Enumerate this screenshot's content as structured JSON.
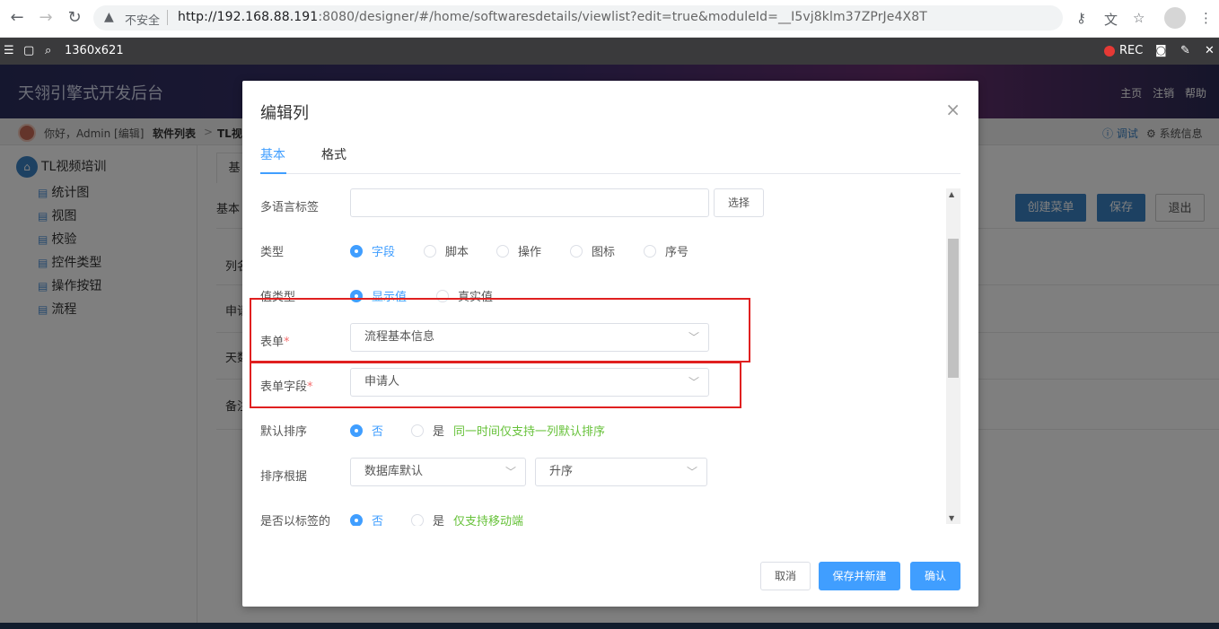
{
  "browser": {
    "insecure_label": "不安全",
    "url_host": "http://192.168.88.191",
    "url_rest": ":8080/designer/#/home/softwaresdetails/viewlist?edit=true&moduleId=__I5vj8klm37ZPrJe4X8T"
  },
  "devbar": {
    "size": "1360x621",
    "rec": "REC"
  },
  "app": {
    "title": "天翎引擎式开发后台",
    "links": [
      "主页",
      "注销",
      "帮助"
    ],
    "greeting": "你好，Admin [编辑]",
    "breadcrumb": [
      "软件列表",
      "TL视"
    ],
    "right_links": [
      "调试",
      "系统信息"
    ],
    "tree_root": "TL视频培训",
    "tree_items": [
      "统计图",
      "视图",
      "校验",
      "控件类型",
      "操作按钮",
      "流程"
    ],
    "content_tab": "基",
    "content_left_labels": [
      "基本",
      "列名",
      "申请",
      "天数",
      "备注"
    ],
    "buttons": {
      "create_menu": "创建菜单",
      "save": "保存",
      "exit": "退出"
    }
  },
  "dialog": {
    "title": "编辑列",
    "tabs": [
      "基本",
      "格式"
    ],
    "fields": {
      "multilang_label": "多语言标签",
      "choose_btn": "选择",
      "type_label": "类型",
      "type_options": [
        "字段",
        "脚本",
        "操作",
        "图标",
        "序号"
      ],
      "type_selected": "字段",
      "valuetype_label": "值类型",
      "valuetype_options": [
        "显示值",
        "真实值"
      ],
      "form_label": "表单",
      "form_value": "流程基本信息",
      "formfield_label": "表单字段",
      "formfield_value": "申请人",
      "default_sort_label": "默认排序",
      "default_sort_options": [
        "否",
        "是"
      ],
      "default_sort_hint": "同一时间仅支持一列默认排序",
      "sort_by_label": "排序根据",
      "sort_by_value": "数据库默认",
      "sort_order_value": "升序",
      "as_tag_label": "是否以标签的",
      "as_tag_options": [
        "否",
        "是"
      ],
      "as_tag_hint": "仅支持移动端"
    },
    "footer": {
      "cancel": "取消",
      "save_new": "保存并新建",
      "confirm": "确认"
    }
  },
  "colors": {
    "accent": "#409eff",
    "highlight": "#e02020",
    "hint": "#67c23a"
  }
}
